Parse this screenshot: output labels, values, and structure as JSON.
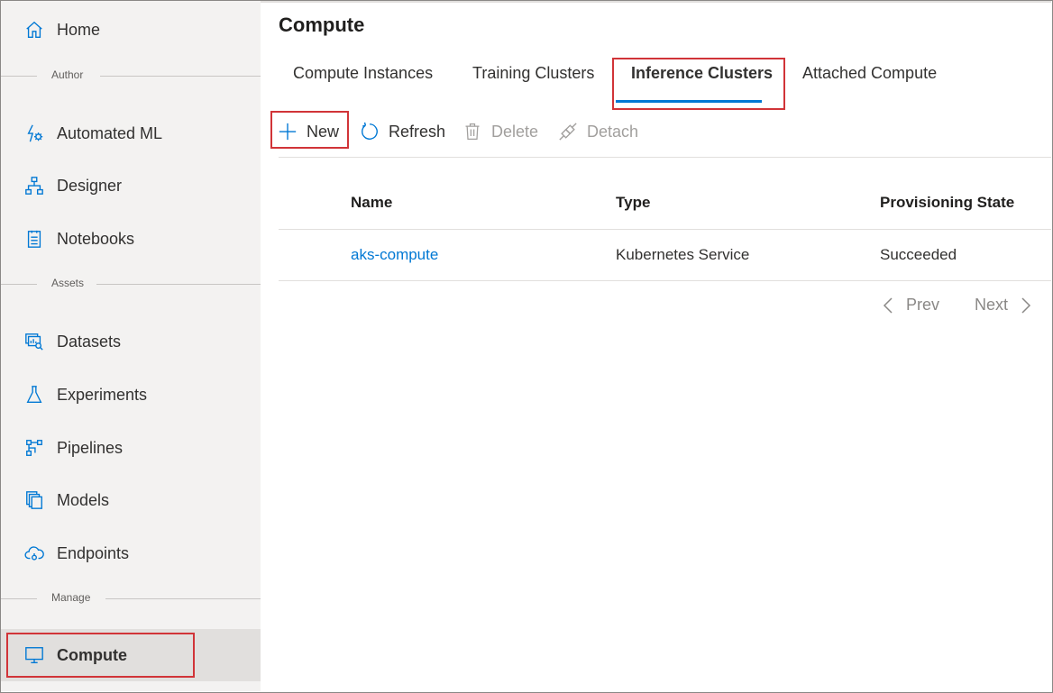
{
  "sidebar": {
    "items": [
      {
        "label": "Home",
        "icon": "home-icon"
      },
      {
        "label": "Automated ML",
        "icon": "automated-ml-icon"
      },
      {
        "label": "Designer",
        "icon": "designer-icon"
      },
      {
        "label": "Notebooks",
        "icon": "notebooks-icon"
      },
      {
        "label": "Datasets",
        "icon": "datasets-icon"
      },
      {
        "label": "Experiments",
        "icon": "experiments-icon"
      },
      {
        "label": "Pipelines",
        "icon": "pipelines-icon"
      },
      {
        "label": "Models",
        "icon": "models-icon"
      },
      {
        "label": "Endpoints",
        "icon": "endpoints-icon"
      },
      {
        "label": "Compute",
        "icon": "compute-icon",
        "active": true
      }
    ],
    "sections": [
      "Author",
      "Assets",
      "Manage"
    ]
  },
  "main": {
    "title": "Compute",
    "tabs": [
      {
        "label": "Compute Instances"
      },
      {
        "label": "Training Clusters"
      },
      {
        "label": "Inference Clusters",
        "active": true
      },
      {
        "label": "Attached Compute"
      }
    ],
    "commands": [
      {
        "label": "New",
        "icon": "plus-icon",
        "enabled": true
      },
      {
        "label": "Refresh",
        "icon": "refresh-icon",
        "enabled": true
      },
      {
        "label": "Delete",
        "icon": "trash-icon",
        "enabled": false
      },
      {
        "label": "Detach",
        "icon": "detach-icon",
        "enabled": false
      }
    ],
    "table": {
      "columns": [
        "Name",
        "Type",
        "Provisioning State"
      ],
      "rows": [
        [
          "aks-compute",
          "Kubernetes Service",
          "Succeeded"
        ]
      ]
    },
    "pager": {
      "prev": "Prev",
      "next": "Next"
    }
  },
  "colors": {
    "accent": "#0078d4",
    "highlight": "#d13438",
    "sidebar_bg": "#f3f2f1",
    "active_bg": "#e1dfdd"
  }
}
